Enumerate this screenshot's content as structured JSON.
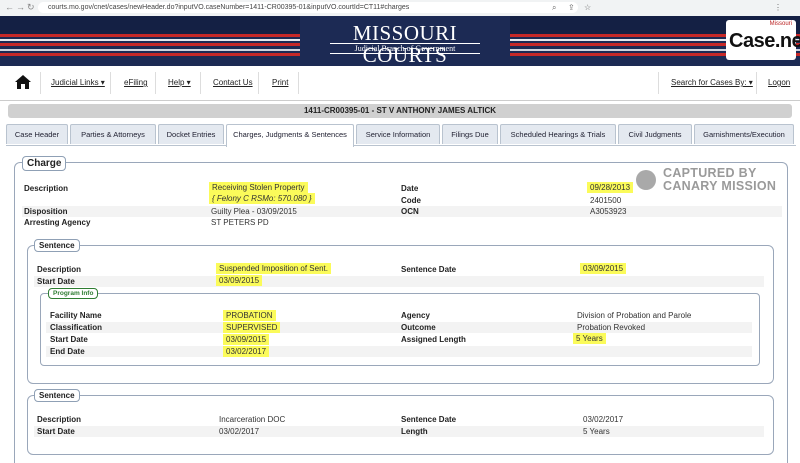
{
  "browser": {
    "url": "courts.mo.gov/cnet/cases/newHeader.do?inputVO.caseNumber=1411-CR00395-01&inputVO.courtId=CT11#charges"
  },
  "banner": {
    "title": "MISSOURI COURTS",
    "subtitle": "Judicial Branch of Government",
    "logo_small": "Missouri",
    "logo_brand": "Case.net"
  },
  "topnav": {
    "judicial_links": "Judicial Links ▾",
    "efiling": "eFiling",
    "help": "Help ▾",
    "contact": "Contact Us",
    "print": "Print",
    "search": "Search for Cases By: ▾",
    "logon": "Logon"
  },
  "case_header": "1411-CR00395-01 - ST V ANTHONY JAMES ALTICK",
  "tabs": [
    "Case Header",
    "Parties & Attorneys",
    "Docket Entries",
    "Charges, Judgments & Sentences",
    "Service Information",
    "Filings Due",
    "Scheduled Hearings & Trials",
    "Civil Judgments",
    "Garnishments/Execution"
  ],
  "watermark": {
    "line1": "CAPTURED BY",
    "line2": "CANARY MISSION"
  },
  "charge": {
    "legend": "Charge",
    "description_label": "Description",
    "description": "Receiving Stolen Property",
    "description_sub": "{ Felony C RSMo: 570.080 }",
    "disposition_label": "Disposition",
    "disposition": "Guilty Plea - 03/09/2015",
    "agency_label": "Arresting Agency",
    "agency": "ST PETERS PD",
    "date_label": "Date",
    "date": "09/28/2013",
    "code_label": "Code",
    "code": "2401500",
    "ocn_label": "OCN",
    "ocn": "A3053923"
  },
  "sentence1": {
    "legend": "Sentence",
    "description_label": "Description",
    "description": "Suspended Imposition of Sent.",
    "start_label": "Start Date",
    "start": "03/09/2015",
    "sentence_date_label": "Sentence Date",
    "sentence_date": "03/09/2015",
    "program": {
      "legend": "Program Info",
      "facility_label": "Facility Name",
      "facility": "PROBATION",
      "classification_label": "Classification",
      "classification": "SUPERVISED",
      "start_label": "Start Date",
      "start": "03/09/2015",
      "end_label": "End Date",
      "end": "03/02/2017",
      "agency_label": "Agency",
      "agency": "Division of Probation and Parole",
      "outcome_label": "Outcome",
      "outcome": "Probation Revoked",
      "length_label": "Assigned Length",
      "length": "5 Years"
    }
  },
  "sentence2": {
    "legend": "Sentence",
    "description_label": "Description",
    "description": "Incarceration DOC",
    "start_label": "Start Date",
    "start": "03/02/2017",
    "sentence_date_label": "Sentence Date",
    "sentence_date": "03/02/2017",
    "length_label": "Length",
    "length": "5 Years"
  },
  "colors": {
    "banner": "#1c2a54",
    "highlight": "#fbfb5a",
    "tab": "#e4e9f0",
    "border": "#9aa7ba",
    "program_legend": "#2e7d32"
  }
}
